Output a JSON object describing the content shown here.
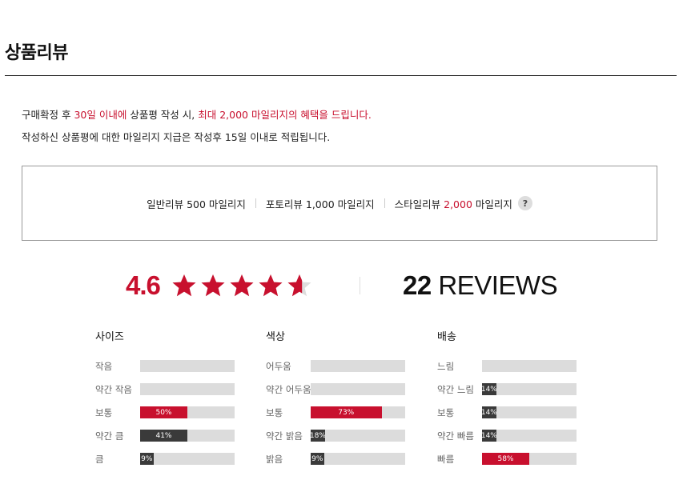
{
  "title": "상품리뷰",
  "notice": {
    "line1_pre": "구매확정 후 ",
    "line1_days": "30일 이내에",
    "line1_mid": " 상품평 작성 시, ",
    "line1_benefit": "최대 2,000 마일리지의 혜택을 드립니다.",
    "line2": "작성하신 상품평에 대한 마일리지 지급은 작성후 15일 이내로 적립됩니다."
  },
  "mileage": {
    "general": "일반리뷰 500 마일리지",
    "photo": "포토리뷰 1,000 마일리지",
    "style_label": "스타일리뷰 ",
    "style_amount": "2,000",
    "style_unit": " 마일리지",
    "help_label": "?"
  },
  "summary": {
    "rating": "4.6",
    "rating_value": 4.6,
    "stars_max": 5,
    "review_count": "22",
    "reviews_label": "REVIEWS"
  },
  "colors": {
    "accent": "#c8102e",
    "bar_dark": "#3a3a3a",
    "bar_bg": "#dcdcdc"
  },
  "attributes": [
    {
      "title": "사이즈",
      "rows": [
        {
          "label": "작음",
          "percent": 0,
          "text": "",
          "highlight": false
        },
        {
          "label": "약간 작음",
          "percent": 0,
          "text": "",
          "highlight": false
        },
        {
          "label": "보통",
          "percent": 50,
          "text": "50%",
          "highlight": true
        },
        {
          "label": "약간 큼",
          "percent": 50,
          "text": "41%",
          "highlight": false
        },
        {
          "label": "큼",
          "percent": 14,
          "text": "9%",
          "highlight": false
        }
      ]
    },
    {
      "title": "색상",
      "rows": [
        {
          "label": "어두움",
          "percent": 0,
          "text": "",
          "highlight": false
        },
        {
          "label": "약간 어두움",
          "percent": 0,
          "text": "",
          "highlight": false
        },
        {
          "label": "보통",
          "percent": 75,
          "text": "73%",
          "highlight": true
        },
        {
          "label": "약간 밝음",
          "percent": 15,
          "text": "18%",
          "highlight": false
        },
        {
          "label": "밝음",
          "percent": 14,
          "text": "9%",
          "highlight": false
        }
      ]
    },
    {
      "title": "배송",
      "rows": [
        {
          "label": "느림",
          "percent": 0,
          "text": "",
          "highlight": false
        },
        {
          "label": "약간 느림",
          "percent": 15,
          "text": "14%",
          "highlight": false
        },
        {
          "label": "보통",
          "percent": 15,
          "text": "14%",
          "highlight": false
        },
        {
          "label": "약간 빠름",
          "percent": 15,
          "text": "14%",
          "highlight": false
        },
        {
          "label": "빠름",
          "percent": 50,
          "text": "58%",
          "highlight": true
        }
      ]
    }
  ]
}
